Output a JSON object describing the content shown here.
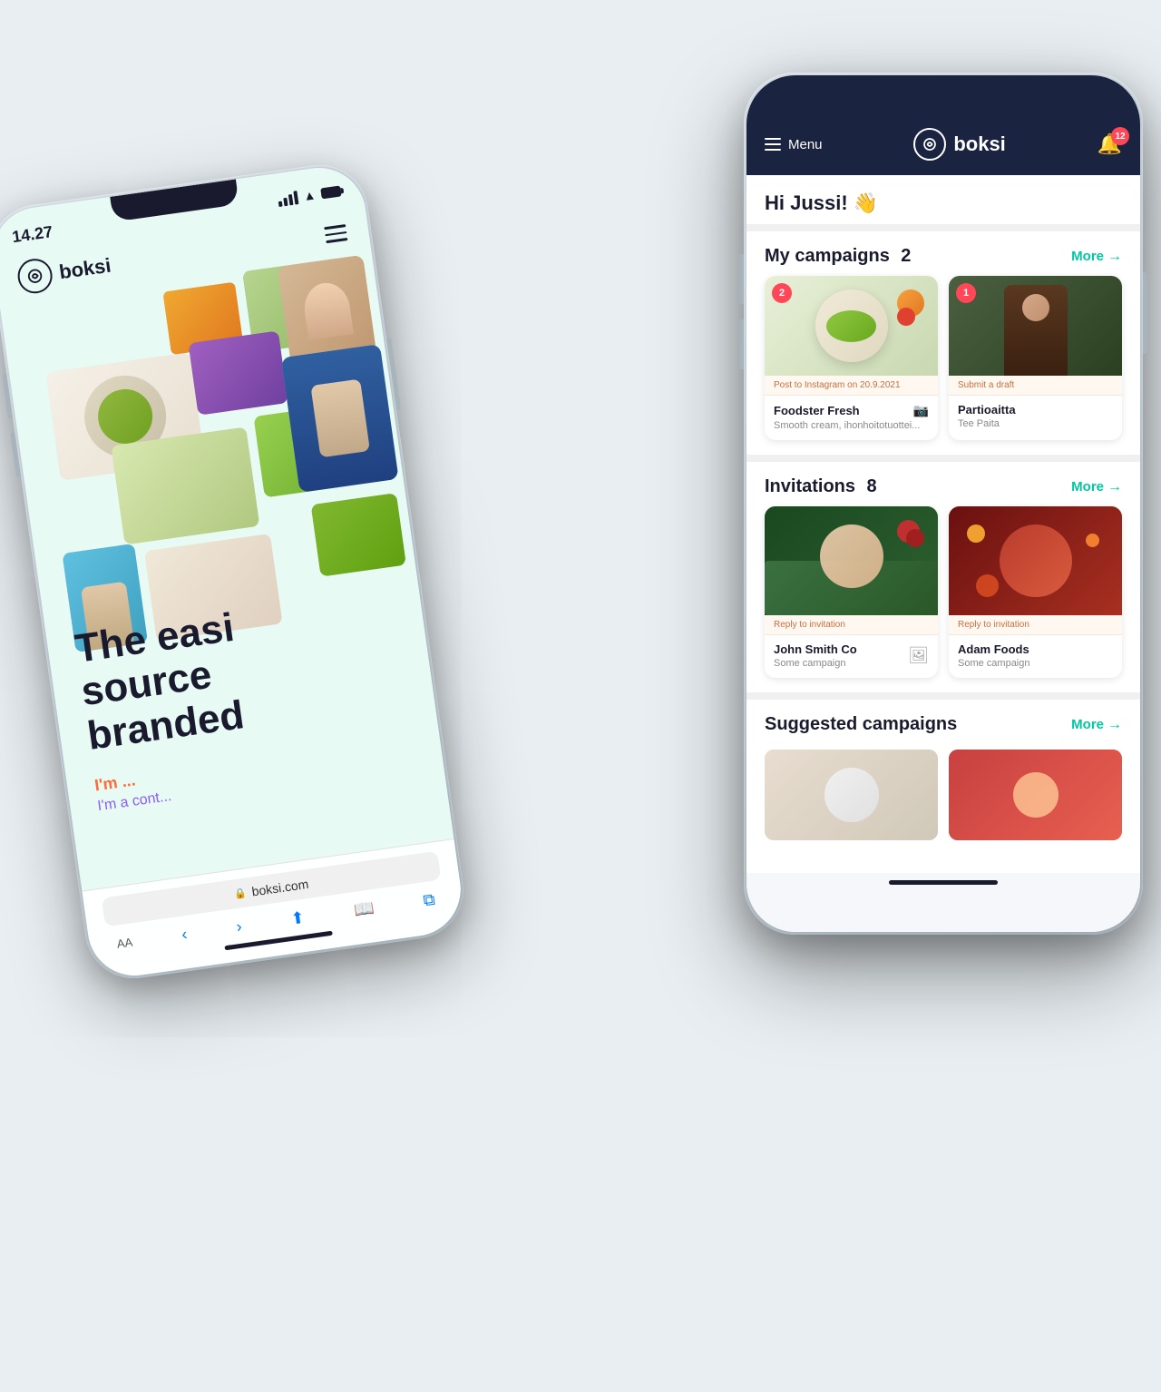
{
  "background": "#e8eef2",
  "phones": {
    "left": {
      "time": "14.27",
      "logo": "boksi",
      "hero_lines": [
        "The easi",
        "source",
        "branded"
      ],
      "cta_primary": "I'm ...",
      "cta_secondary": "I'm a cont...",
      "url": "boksi.com",
      "bottom_controls": {
        "font_size": "AA",
        "share": "share",
        "bookmarks": "bookmarks",
        "tabs": "tabs"
      }
    },
    "right": {
      "menu_label": "Menu",
      "logo": "boksi",
      "notification_count": "12",
      "greeting": "Hi Jussi! 👋",
      "campaigns": {
        "title": "My campaigns",
        "count": "2",
        "more_label": "More",
        "items": [
          {
            "badge": "2",
            "status": "Post to Instagram on 20.9.2021",
            "brand": "Foodster Fresh",
            "subtitle": "Smooth cream, ihonhoitotuottei...",
            "has_instagram": true
          },
          {
            "badge": "1",
            "status": "Submit a draft",
            "brand": "Partioaitta",
            "subtitle": "Tee Paita",
            "has_instagram": false
          }
        ]
      },
      "invitations": {
        "title": "Invitations",
        "count": "8",
        "more_label": "More",
        "items": [
          {
            "status": "Reply to invitation",
            "brand": "John Smith Co",
            "subtitle": "Some campaign",
            "has_img_placeholder": true
          },
          {
            "status": "Reply to invitation",
            "brand": "Adam Foods",
            "subtitle": "Some campaign",
            "has_img_placeholder": false
          }
        ]
      },
      "suggested": {
        "title": "Suggested campaigns",
        "more_label": "More"
      }
    }
  }
}
